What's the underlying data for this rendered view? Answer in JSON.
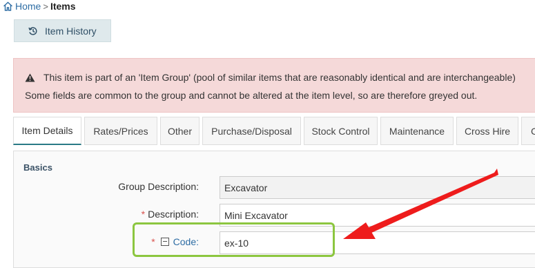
{
  "breadcrumb": {
    "home": "Home",
    "separator": ">",
    "current": "Items"
  },
  "toolbar": {
    "history_label": "Item History"
  },
  "alert": {
    "line1": "This item is part of an 'Item Group' (pool of similar items that are reasonably identical and are interchangeable)",
    "line2": "Some fields are common to the group and cannot be altered at the item level, so are therefore greyed out."
  },
  "tabs": [
    {
      "label": "Item Details"
    },
    {
      "label": "Rates/Prices"
    },
    {
      "label": "Other"
    },
    {
      "label": "Purchase/Disposal"
    },
    {
      "label": "Stock Control"
    },
    {
      "label": "Maintenance"
    },
    {
      "label": "Cross Hire"
    },
    {
      "label": "Co"
    }
  ],
  "basics": {
    "title": "Basics",
    "group_description_label": "Group Description:",
    "group_description_value": "Excavator",
    "description_label": "Description:",
    "description_value": "Mini Excavator",
    "code_label": "Code:",
    "code_value": "ex-10",
    "required_mark": "*"
  },
  "annotation": {
    "highlight_color": "#8cc63f",
    "arrow_color": "#ee1c1c"
  }
}
